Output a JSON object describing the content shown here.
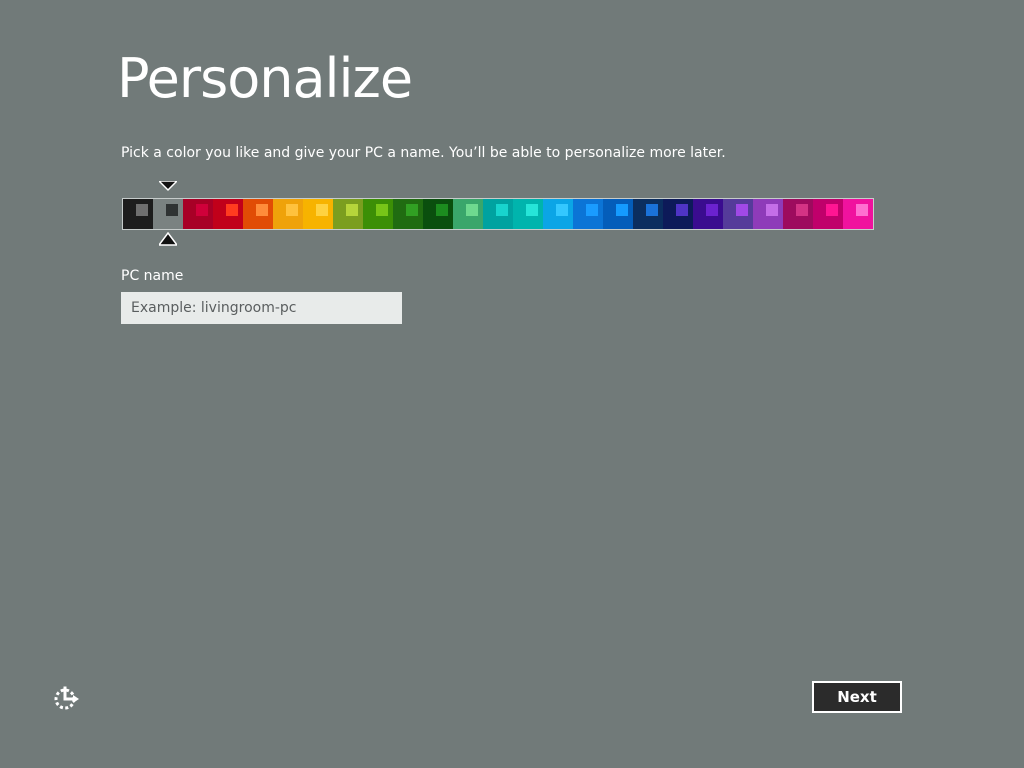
{
  "header": {
    "title": "Personalize",
    "subtitle": "Pick a color you like and give your PC a name. You’ll be able to personalize more later."
  },
  "color_picker": {
    "selected_index": 1,
    "swatches": [
      {
        "bg": "#1d1d1d",
        "fg": "#6f6f6f"
      },
      {
        "bg": "#7a8281",
        "fg": "#2f3333"
      },
      {
        "bg": "#a80026",
        "fg": "#d0003a"
      },
      {
        "bg": "#c1001a",
        "fg": "#ff3b1f"
      },
      {
        "bg": "#e14c05",
        "fg": "#ff8c3a"
      },
      {
        "bg": "#efa20a",
        "fg": "#ffc23d"
      },
      {
        "bg": "#f7b300",
        "fg": "#ffd240"
      },
      {
        "bg": "#7b9e1f",
        "fg": "#b6d53b"
      },
      {
        "bg": "#3c8f06",
        "fg": "#78c518"
      },
      {
        "bg": "#206c11",
        "fg": "#31a023"
      },
      {
        "bg": "#0a4f0e",
        "fg": "#1c8c1f"
      },
      {
        "bg": "#3aa66b",
        "fg": "#6fd98f"
      },
      {
        "bg": "#00a2a0",
        "fg": "#18d4cd"
      },
      {
        "bg": "#00b4ad",
        "fg": "#26e5d8"
      },
      {
        "bg": "#0ba5e6",
        "fg": "#34c8ff"
      },
      {
        "bg": "#0b74d6",
        "fg": "#1a9cff"
      },
      {
        "bg": "#045dba",
        "fg": "#159bff"
      },
      {
        "bg": "#0b2e5f",
        "fg": "#1a72d9"
      },
      {
        "bg": "#0d1a59",
        "fg": "#4f34c5"
      },
      {
        "bg": "#3a0c8f",
        "fg": "#6b22cf"
      },
      {
        "bg": "#553b9a",
        "fg": "#a049e6"
      },
      {
        "bg": "#8e3bb9",
        "fg": "#c46ee8"
      },
      {
        "bg": "#9d0b5e",
        "fg": "#d33385"
      },
      {
        "bg": "#c0006b",
        "fg": "#ff1593"
      },
      {
        "bg": "#f0129e",
        "fg": "#ff6fd0"
      }
    ]
  },
  "form": {
    "pc_name_label": "PC name",
    "pc_name_value": "",
    "pc_name_placeholder": "Example: livingroom-pc"
  },
  "footer": {
    "next_label": "Next",
    "ease_icon": "ease-of-access-icon"
  }
}
